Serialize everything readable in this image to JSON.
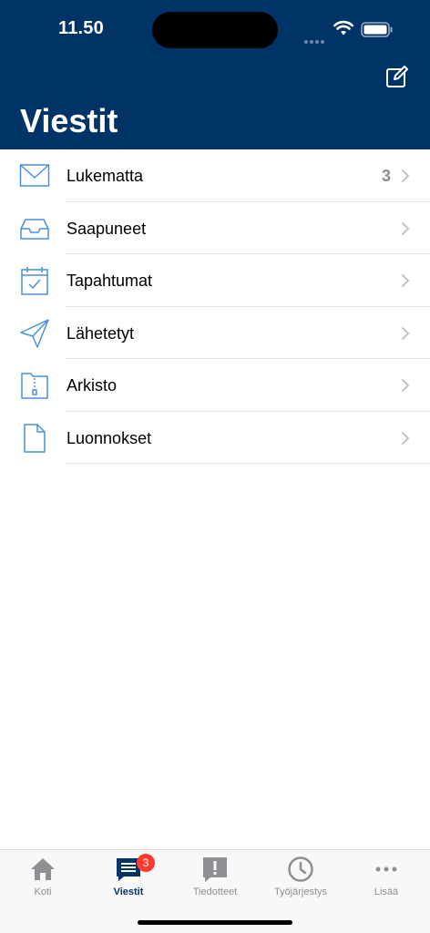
{
  "status_bar": {
    "time": "11.50"
  },
  "header": {
    "title": "Viestit",
    "compose_icon": "compose-icon",
    "background": "#003366"
  },
  "folders": [
    {
      "label": "Lukematta",
      "count": "3",
      "icon": "envelope-icon"
    },
    {
      "label": "Saapuneet",
      "count": "",
      "icon": "inbox-tray-icon"
    },
    {
      "label": "Tapahtumat",
      "count": "",
      "icon": "calendar-check-icon"
    },
    {
      "label": "Lähetetyt",
      "count": "",
      "icon": "paper-plane-icon"
    },
    {
      "label": "Arkisto",
      "count": "",
      "icon": "archive-folder-icon"
    },
    {
      "label": "Luonnokset",
      "count": "",
      "icon": "document-icon"
    }
  ],
  "tabbar": {
    "tabs": [
      {
        "label": "Koti",
        "icon": "home-icon",
        "active": false
      },
      {
        "label": "Viestit",
        "icon": "messages-icon",
        "active": true,
        "badge": "3"
      },
      {
        "label": "Tiedotteet",
        "icon": "announcement-icon",
        "active": false
      },
      {
        "label": "Työjärjestys",
        "icon": "clock-icon",
        "active": false
      },
      {
        "label": "Lisää",
        "icon": "more-icon",
        "active": false
      }
    ]
  },
  "colors": {
    "accent": "#003366",
    "icon_blue": "#4a90d9",
    "badge": "#ff3b30"
  }
}
